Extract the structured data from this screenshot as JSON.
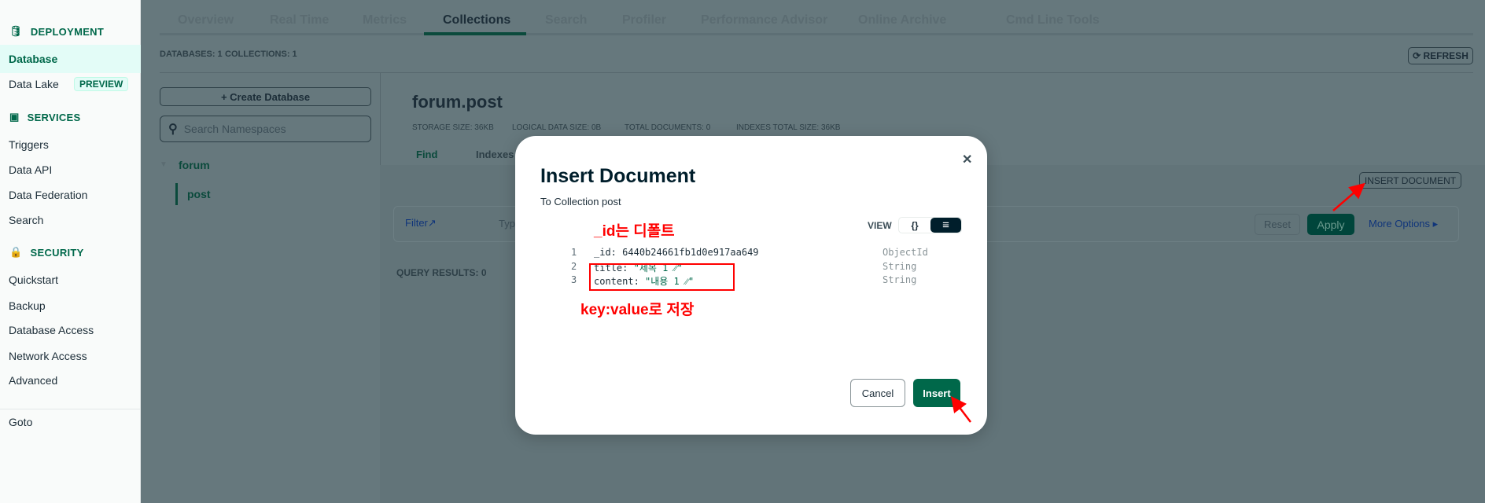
{
  "sidebar": {
    "deployment": "DEPLOYMENT",
    "database": "Database",
    "data_lake": "Data Lake",
    "preview_badge": "PREVIEW",
    "services": "SERVICES",
    "triggers": "Triggers",
    "data_api": "Data API",
    "data_federation": "Data Federation",
    "search": "Search",
    "security": "SECURITY",
    "quickstart": "Quickstart",
    "backup": "Backup",
    "database_access": "Database Access",
    "network_access": "Network Access",
    "advanced": "Advanced",
    "goto": "Goto"
  },
  "tabs": [
    "Overview",
    "Real Time",
    "Metrics",
    "Collections",
    "Search",
    "Profiler",
    "Performance Advisor",
    "Online Archive",
    "Cmd Line Tools"
  ],
  "active_tab": "Collections",
  "summary": {
    "databases": "DATABASES: 1",
    "collections": "COLLECTIONS: 1",
    "refresh": "REFRESH"
  },
  "left_panel": {
    "create_db": "Create Database",
    "search_placeholder": "Search Namespaces",
    "db": "forum",
    "collection": "post"
  },
  "collection": {
    "title": "forum.post",
    "storage": "STORAGE SIZE: 36KB",
    "logical": "LOGICAL DATA SIZE: 0B",
    "docs": "TOTAL DOCUMENTS: 0",
    "indexes_size": "INDEXES TOTAL SIZE: 36KB",
    "find_tab": "Find",
    "indexes_tab": "Indexes",
    "insert_document": "INSERT DOCUMENT",
    "filter": "Filter",
    "type": "Typ",
    "reset": "Reset",
    "apply": "Apply",
    "more_options": "More Options",
    "query_results": "QUERY RESULTS:",
    "query_count": "0"
  },
  "modal": {
    "title": "Insert Document",
    "subtitle": "To Collection post",
    "view": "VIEW",
    "json_toggle": "{}",
    "list_toggle": "≡",
    "cancel": "Cancel",
    "insert": "Insert",
    "lines": [
      {
        "num": "1",
        "key": "_id:",
        "value": "6440b24661fb1d0e917aa649",
        "type": "ObjectId"
      },
      {
        "num": "2",
        "key": "title:",
        "value": "\"제목 1    ⁄⁄\"",
        "type": "String"
      },
      {
        "num": "3",
        "key": "content:",
        "value": "\"내용 1     ⁄⁄\"",
        "type": "String"
      }
    ]
  },
  "annotations": {
    "id_note": "_id는 디폴트",
    "kv_note": "key:value로 저장",
    "color": "#ff0000"
  },
  "colors": {
    "brand": "#00684a",
    "apply": "#00594a",
    "overlay": "#66787d"
  }
}
